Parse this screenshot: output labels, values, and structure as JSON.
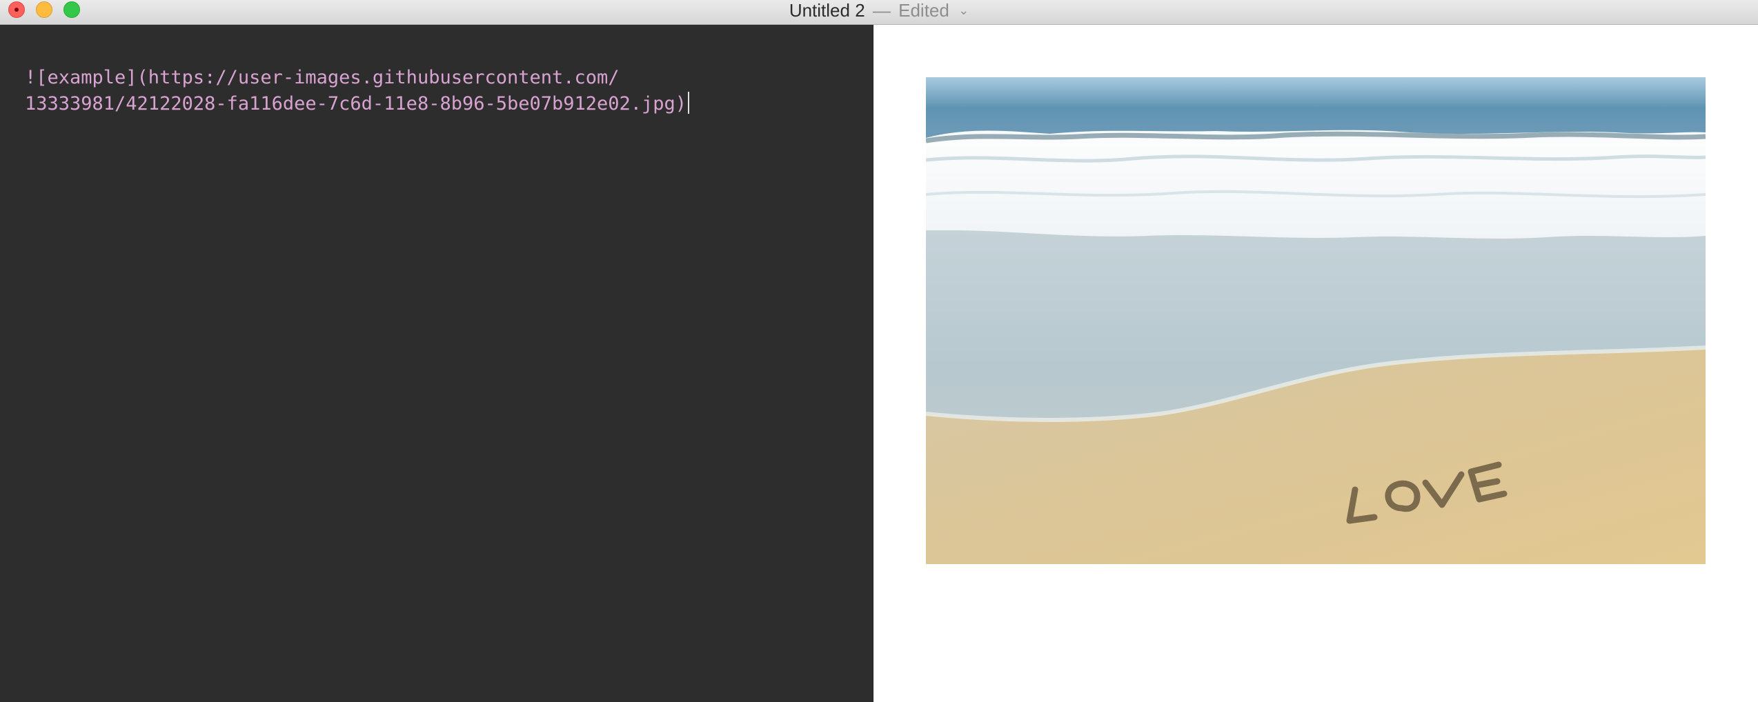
{
  "window": {
    "title": "Untitled 2",
    "separator": "—",
    "status": "Edited",
    "controls": {
      "close": "close-button",
      "minimize": "minimize-button",
      "zoom": "zoom-button"
    }
  },
  "editor": {
    "lines": [
      "![example](https://user-images.githubusercontent.com/",
      "13333981/42122028-fa116dee-7c6d-11e8-8b96-5be07b912e02.jpg)"
    ],
    "text_color": "#d9a3d1",
    "background": "#2d2d2d"
  },
  "preview": {
    "image_alt": "example",
    "image_text": "LOVE"
  }
}
